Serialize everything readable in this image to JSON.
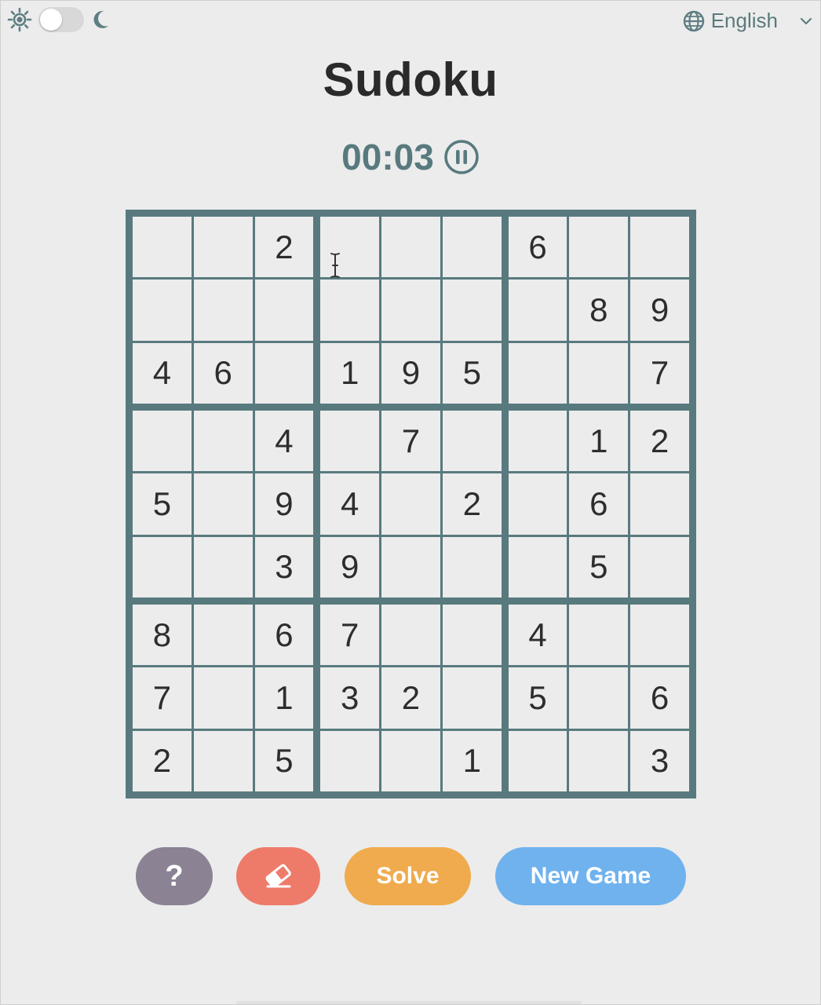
{
  "header": {
    "language": "English"
  },
  "title": "Sudoku",
  "timer": "00:03",
  "board": [
    [
      "",
      "",
      "2",
      "",
      "",
      "",
      "6",
      "",
      ""
    ],
    [
      "",
      "",
      "",
      "",
      "",
      "",
      "",
      "8",
      "9"
    ],
    [
      "4",
      "6",
      "",
      "1",
      "9",
      "5",
      "",
      "",
      "7"
    ],
    [
      "",
      "",
      "4",
      "",
      "7",
      "",
      "",
      "1",
      "2"
    ],
    [
      "5",
      "",
      "9",
      "4",
      "",
      "2",
      "",
      "6",
      ""
    ],
    [
      "",
      "",
      "3",
      "9",
      "",
      "",
      "",
      "5",
      ""
    ],
    [
      "8",
      "",
      "6",
      "7",
      "",
      "",
      "4",
      "",
      ""
    ],
    [
      "7",
      "",
      "1",
      "3",
      "2",
      "",
      "5",
      "",
      "6"
    ],
    [
      "2",
      "",
      "5",
      "",
      "",
      "1",
      "",
      "",
      "3"
    ]
  ],
  "buttons": {
    "hint": "?",
    "solve": "Solve",
    "new_game": "New Game"
  },
  "colors": {
    "accent": "#587a7e",
    "hint": "#8b8294",
    "erase": "#ee7b6a",
    "solve": "#f0ab4e",
    "new_game": "#6fb2ee"
  }
}
